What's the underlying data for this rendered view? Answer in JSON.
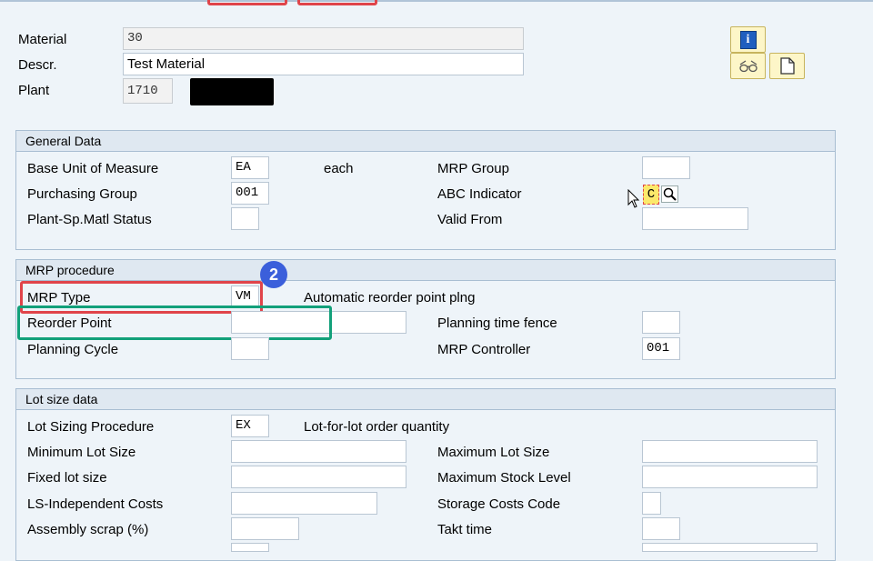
{
  "header": {
    "material_label": "Material",
    "material_value": "30",
    "descr_label": "Descr.",
    "descr_value": "Test Material",
    "plant_label": "Plant",
    "plant_value": "1710"
  },
  "toolbar": {
    "info_icon": "info-icon",
    "glasses_icon": "glasses-icon",
    "document_icon": "document-icon"
  },
  "general": {
    "title": "General Data",
    "base_uom_label": "Base Unit of Measure",
    "base_uom_value": "EA",
    "base_uom_text": "each",
    "purch_group_label": "Purchasing Group",
    "purch_group_value": "001",
    "plant_status_label": "Plant-Sp.Matl Status",
    "plant_status_value": "",
    "mrp_group_label": "MRP Group",
    "mrp_group_value": "",
    "abc_label": "ABC Indicator",
    "abc_value": "C",
    "valid_from_label": "Valid From",
    "valid_from_value": ""
  },
  "mrp": {
    "title": "MRP procedure",
    "badge": "2",
    "mrp_type_label": "MRP Type",
    "mrp_type_value": "VM",
    "mrp_type_text": "Automatic reorder point plng",
    "reorder_label": "Reorder Point",
    "reorder_value": "",
    "planning_cycle_label": "Planning Cycle",
    "planning_cycle_value": "",
    "ptf_label": "Planning time fence",
    "ptf_value": "",
    "controller_label": "MRP Controller",
    "controller_value": "001"
  },
  "lot": {
    "title": "Lot size data",
    "procedure_label": "Lot Sizing Procedure",
    "procedure_value": "EX",
    "procedure_text": "Lot-for-lot order quantity",
    "min_label": "Minimum Lot Size",
    "max_label": "Maximum Lot Size",
    "fixed_label": "Fixed lot size",
    "max_stock_label": "Maximum Stock Level",
    "ls_costs_label": "LS-Independent Costs",
    "storage_label": "Storage Costs Code",
    "scrap_label": "Assembly scrap (%)",
    "takt_label": "Takt time"
  },
  "colors": {
    "highlight_red": "#e0444a",
    "highlight_green": "#12a07a",
    "badge_blue": "#3b5fdb"
  }
}
